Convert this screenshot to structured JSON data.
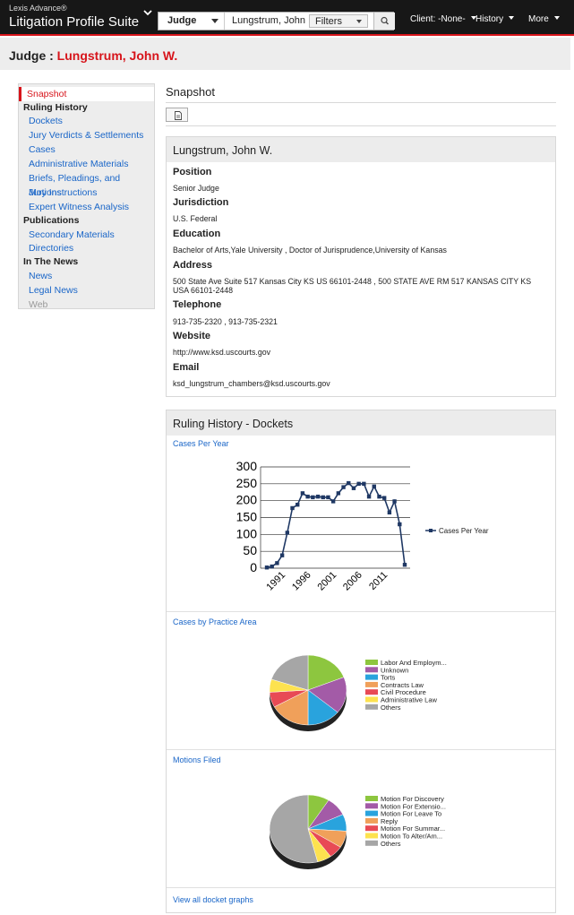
{
  "app": {
    "brand_small": "Lexis Advance®",
    "brand_big": "Litigation Profile Suite"
  },
  "search": {
    "type_label": "Judge",
    "value": "Lungstrum, John",
    "filters_label": "Filters"
  },
  "nav_menus": {
    "client": "Client: -None-",
    "history": "History",
    "more": "More"
  },
  "page": {
    "title_prefix": "Judge : ",
    "title_name": "Lungstrum, John W."
  },
  "sidebar": {
    "items": [
      {
        "label": "Snapshot",
        "kind": "active"
      },
      {
        "label": "Ruling History",
        "kind": "head"
      },
      {
        "label": "Dockets",
        "kind": "link"
      },
      {
        "label": "Jury Verdicts & Settlements",
        "kind": "link"
      },
      {
        "label": "Cases",
        "kind": "link"
      },
      {
        "label": "Administrative Materials",
        "kind": "link"
      },
      {
        "label": "Briefs, Pleadings, and Motions",
        "kind": "link"
      },
      {
        "label": "Jury Instructions",
        "kind": "link"
      },
      {
        "label": "Expert Witness Analysis",
        "kind": "link"
      },
      {
        "label": "Publications",
        "kind": "head"
      },
      {
        "label": "Secondary Materials",
        "kind": "link"
      },
      {
        "label": "Directories",
        "kind": "link"
      },
      {
        "label": "In The News",
        "kind": "head"
      },
      {
        "label": "News",
        "kind": "link"
      },
      {
        "label": "Legal News",
        "kind": "link"
      },
      {
        "label": "Web",
        "kind": "disabled"
      }
    ]
  },
  "main": {
    "section_title": "Snapshot"
  },
  "profile": {
    "name": "Lungstrum, John W.",
    "position_label": "Position",
    "position": "Senior Judge",
    "jurisdiction_label": "Jurisdiction",
    "jurisdiction": "U.S. Federal",
    "education_label": "Education",
    "education": "Bachelor of Arts,Yale University , Doctor of Jurisprudence,University of Kansas",
    "address_label": "Address",
    "address": "500 State Ave Suite 517 Kansas City KS US 66101-2448 , 500 STATE AVE RM 517 KANSAS CITY KS USA 66101-2448",
    "telephone_label": "Telephone",
    "telephone": "913-735-2320 , 913-735-2321",
    "website_label": "Website",
    "website": "http://www.ksd.uscourts.gov",
    "email_label": "Email",
    "email": "ksd_lungstrum_chambers@ksd.uscourts.gov"
  },
  "dockets": {
    "title": "Ruling History - Dockets",
    "cases_per_year_link": "Cases Per Year",
    "practice_area_link": "Cases by Practice Area",
    "motions_link": "Motions Filed",
    "view_all_link": "View all docket graphs"
  },
  "chart_data": [
    {
      "type": "line",
      "title": "",
      "series": [
        {
          "name": "Cases Per Year",
          "x": [
            1988,
            1989,
            1990,
            1991,
            1992,
            1993,
            1994,
            1995,
            1996,
            1997,
            1998,
            1999,
            2000,
            2001,
            2002,
            2003,
            2004,
            2005,
            2006,
            2007,
            2008,
            2009,
            2010,
            2011,
            2012,
            2013
          ],
          "values": [
            2,
            5,
            15,
            38,
            105,
            178,
            188,
            222,
            212,
            210,
            212,
            210,
            210,
            198,
            222,
            240,
            252,
            237,
            250,
            250,
            212,
            242,
            212,
            208,
            165,
            198
          ],
          "color": "#1f3864"
        }
      ],
      "extra_tail": [
        {
          "x": 2014,
          "y": 130
        },
        {
          "x": 2015,
          "y": 10
        }
      ],
      "ylim": [
        0,
        300
      ],
      "yticks": [
        0,
        50,
        100,
        150,
        200,
        250,
        300
      ],
      "xtick_labels": [
        "1991",
        "1996",
        "2001",
        "2006",
        "2011"
      ],
      "grid": true,
      "legend": "right"
    },
    {
      "type": "pie",
      "legend_entries": [
        "Labor And Employm...",
        "Unknown",
        "Torts",
        "Contracts Law",
        "Civil Procedure",
        "Administrative Law",
        "Others"
      ],
      "values": [
        19,
        17,
        14,
        17,
        7,
        6,
        20
      ],
      "colors": [
        "#8dc63f",
        "#a35ba7",
        "#29a3dd",
        "#f0a05a",
        "#e84a55",
        "#fde24f",
        "#a6a6a6"
      ],
      "legend": "right"
    },
    {
      "type": "pie",
      "legend_entries": [
        "Motion For Discovery",
        "Motion For Extensio...",
        "Motion For Leave To",
        "Reply",
        "Motion For Summar...",
        "Motion To Alter/Am...",
        "Others"
      ],
      "values": [
        9,
        9,
        8,
        8,
        6,
        6,
        54
      ],
      "colors": [
        "#8dc63f",
        "#a35ba7",
        "#29a3dd",
        "#f0a05a",
        "#e84a55",
        "#fde24f",
        "#a6a6a6"
      ],
      "legend": "right"
    }
  ]
}
